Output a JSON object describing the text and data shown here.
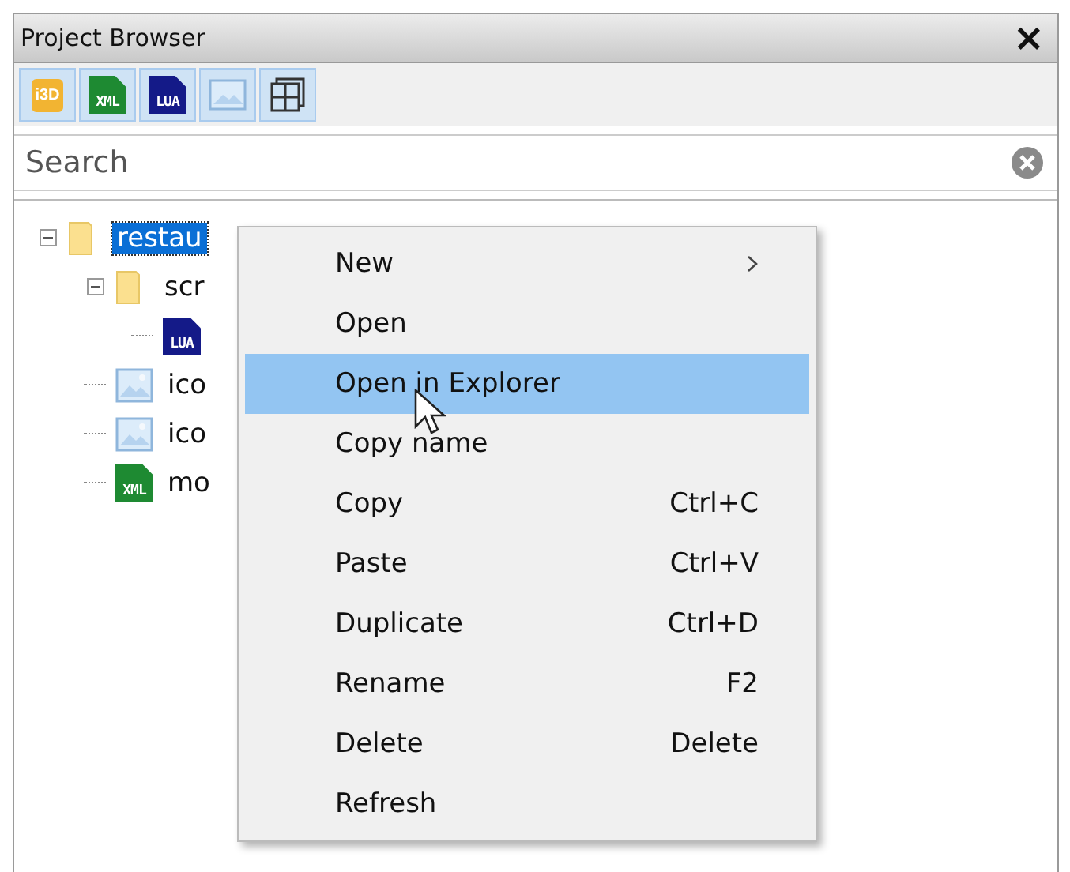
{
  "window": {
    "title": "Project Browser",
    "close": "×"
  },
  "toolbar": [
    {
      "kind": "i3d",
      "label": "i3D"
    },
    {
      "kind": "xml",
      "label": "XML"
    },
    {
      "kind": "lua",
      "label": "LUA"
    },
    {
      "kind": "image"
    },
    {
      "kind": "grid"
    }
  ],
  "search": {
    "placeholder": "Search"
  },
  "tree": [
    {
      "kind": "folder",
      "name": "restau",
      "selected": true,
      "expanded": true,
      "children": [
        {
          "kind": "folder",
          "name": "scr",
          "selected": false,
          "expanded": true,
          "children": [
            {
              "kind": "lua",
              "label": "LUA"
            }
          ]
        },
        {
          "kind": "image",
          "name": "ico",
          "selected": false
        },
        {
          "kind": "image",
          "name": "ico",
          "selected": false
        },
        {
          "kind": "xml",
          "label": "XML",
          "name": "mo",
          "selected": false
        }
      ]
    }
  ],
  "context_menu": [
    {
      "label": "New",
      "submenu": true,
      "selected": false
    },
    {
      "label": "Open",
      "selected": false
    },
    {
      "label": "Open in Explorer",
      "selected": true
    },
    {
      "label": "Copy name",
      "selected": false
    },
    {
      "label": "Copy",
      "shortcut": "Ctrl+C",
      "selected": false
    },
    {
      "label": "Paste",
      "shortcut": "Ctrl+V",
      "selected": false
    },
    {
      "label": "Duplicate",
      "shortcut": "Ctrl+D",
      "selected": false
    },
    {
      "label": "Rename",
      "shortcut": "F2",
      "selected": false
    },
    {
      "label": "Delete",
      "shortcut": "Delete",
      "selected": false
    },
    {
      "label": "Refresh",
      "selected": false
    }
  ]
}
